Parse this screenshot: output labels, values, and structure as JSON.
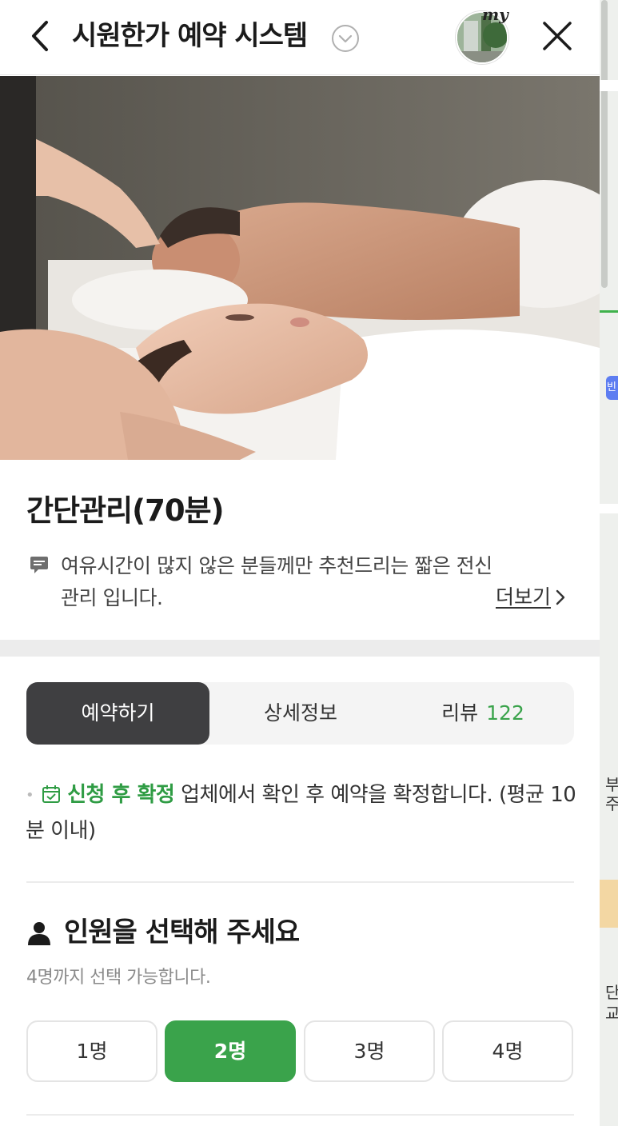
{
  "header": {
    "title": "시원한가 예약 시스템",
    "avatar_tag": "my"
  },
  "product": {
    "name": "간단관리(70분)",
    "description": "여유시간이 많지 않은 분들께만 추천드리는 짧은 전신관리 입니다.",
    "more_label": "더보기",
    "more_icon": "chevron-right-icon"
  },
  "tabs": [
    {
      "label": "예약하기",
      "active": true
    },
    {
      "label": "상세정보",
      "active": false
    },
    {
      "label": "리뷰",
      "count": "122",
      "active": false
    }
  ],
  "notice": {
    "strong": "신청 후 확정",
    "text": " 업체에서 확인 후 예약을 확정합니다. (평균 10분 이내)"
  },
  "people": {
    "title": "인원을 선택해 주세요",
    "hint": "4명까지 선택 가능합니다.",
    "options": [
      "1명",
      "2명",
      "3명",
      "4명"
    ],
    "selected": "2명"
  },
  "map_strip": {
    "labels": [
      "부",
      "주",
      "빈",
      "단",
      "교"
    ]
  },
  "colors": {
    "accent_green": "#3aa34b",
    "tab_active_bg": "#3f3f41"
  }
}
